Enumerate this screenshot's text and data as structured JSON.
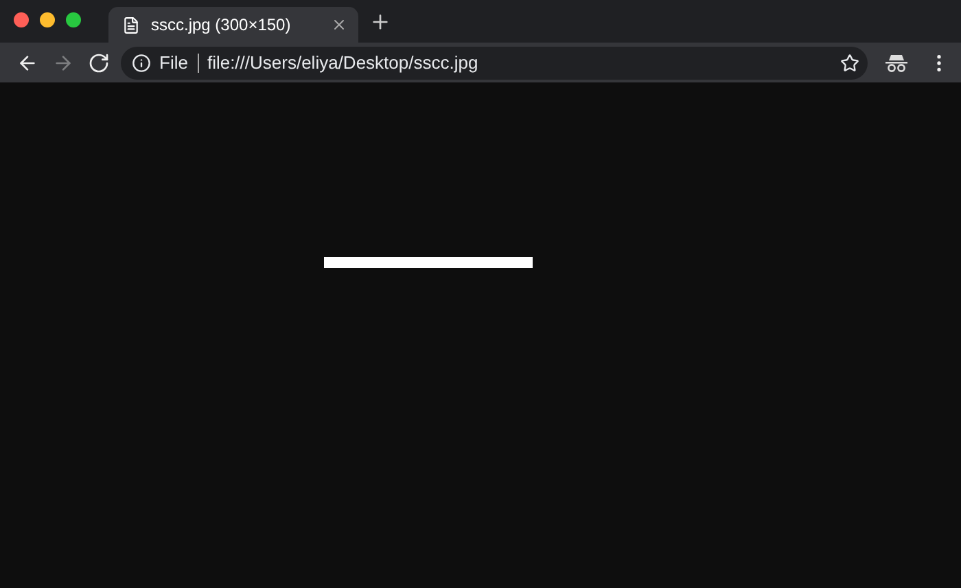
{
  "window": {
    "controls": [
      {
        "color": "#fe5f57"
      },
      {
        "color": "#febc2e"
      },
      {
        "color": "#28c840"
      }
    ]
  },
  "tabs": [
    {
      "title": "sscc.jpg (300×150)",
      "selected": true
    }
  ],
  "toolbar": {
    "nav": [
      {
        "kind": "back",
        "disabled": false
      },
      {
        "kind": "forward",
        "disabled": true
      },
      {
        "kind": "reload",
        "disabled": false
      }
    ],
    "address": {
      "scheme_label": "File",
      "url": "file:///Users/eliya/Desktop/sscc.jpg"
    }
  }
}
